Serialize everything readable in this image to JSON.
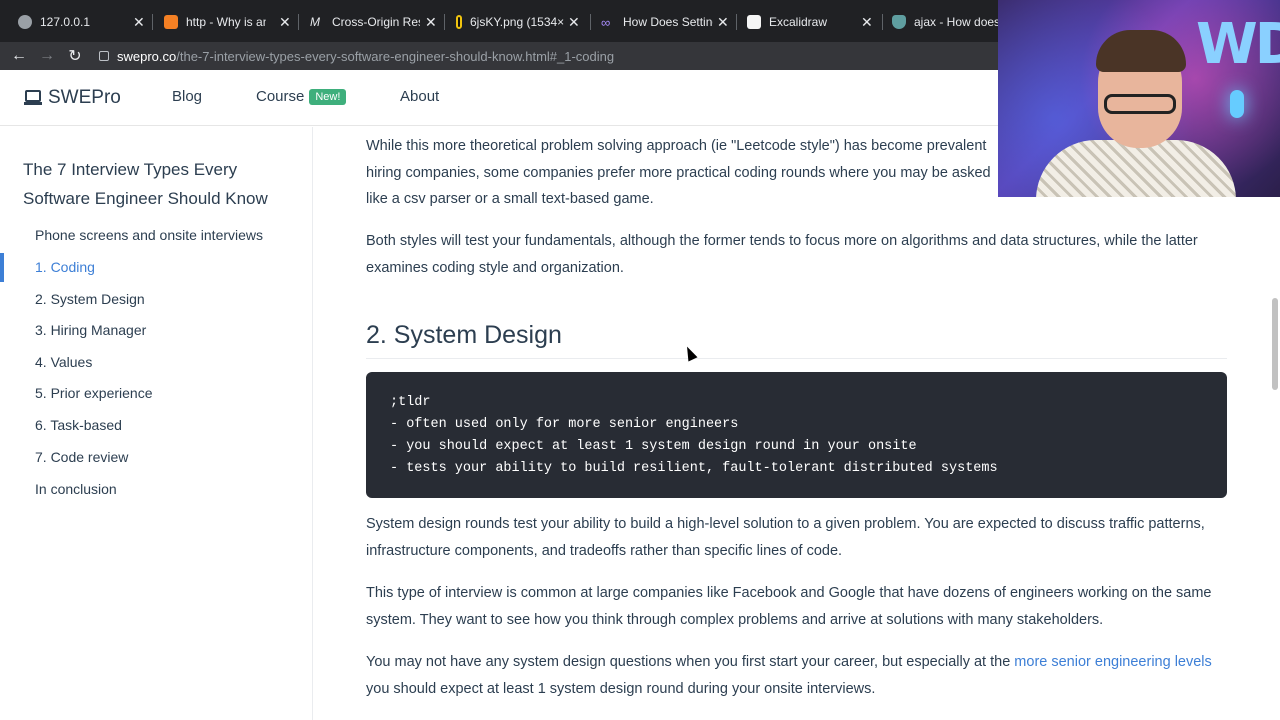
{
  "browser": {
    "tabs": [
      {
        "title": "127.0.0.1",
        "icon": "globe-icon"
      },
      {
        "title": "http - Why is an O",
        "icon": "stackoverflow-icon"
      },
      {
        "title": "Cross-Origin Reso",
        "icon": "mdn-icon"
      },
      {
        "title": "6jsKY.png (1534×",
        "icon": "image-icon"
      },
      {
        "title": "How Does Setting",
        "icon": "infinity-icon"
      },
      {
        "title": "Excalidraw",
        "icon": "excalidraw-icon"
      },
      {
        "title": "ajax - How does",
        "icon": "shield-icon"
      }
    ],
    "url_domain": "swepro.co",
    "url_path": "/the-7-interview-types-every-software-engineer-should-know.html#_1-coding"
  },
  "header": {
    "logo": "SWEPro",
    "nav": {
      "blog": "Blog",
      "course": "Course",
      "course_badge": "New!",
      "about": "About"
    }
  },
  "sidebar": {
    "title": "The 7 Interview Types Every Software Engineer Should Know",
    "items": [
      "Phone screens and onsite interviews",
      "1. Coding",
      "2. System Design",
      "3. Hiring Manager",
      "4. Values",
      "5. Prior experience",
      "6. Task-based",
      "7. Code review",
      "In conclusion"
    ],
    "active_index": 1
  },
  "content": {
    "p1": "While this more theoretical problem solving approach (ie \"Leetcode style\") has become prevalent hiring companies, some companies prefer more practical coding rounds where you may be asked like a csv parser or a small text-based game.",
    "p2": "Both styles will test your fundamentals, although the former tends to focus more on algorithms and data structures, while the latter examines coding style and organization.",
    "h2": "2. System Design",
    "code": ";tldr\n- often used only for more senior engineers\n- you should expect at least 1 system design round in your onsite\n- tests your ability to build resilient, fault-tolerant distributed systems",
    "p3": "System design rounds test your ability to build a high-level solution to a given problem. You are expected to discuss traffic patterns, infrastructure components, and tradeoffs rather than specific lines of code.",
    "p4": "This type of interview is common at large companies like Facebook and Google that have dozens of engineers working on the same system. They want to see how you think through complex problems and arrive at solutions with many stakeholders.",
    "p5_before": "You may not have any system design questions when you first start your career, but especially at the ",
    "p5_link": "more senior engineering levels",
    "p5_after": " you should expect at least 1 system design round during your onsite interviews."
  },
  "webcam": {
    "letters": "WDU"
  }
}
